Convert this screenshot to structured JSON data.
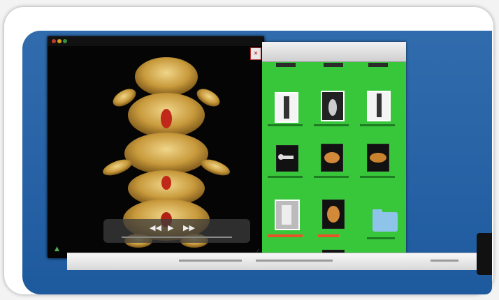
{
  "player": {
    "title": "",
    "close_glyph": "✕",
    "controls": {
      "prev": "◀◀",
      "play": "▶",
      "next": "▶▶"
    },
    "time_elapsed": "",
    "time_remaining": "",
    "fullscreen_icon": "fullscreen-icon",
    "resize_icon": "resize-icon"
  },
  "finder": {
    "background_color": "#38c63a",
    "items": [
      {
        "kind": "xray-dark"
      },
      {
        "kind": "xray-light"
      },
      {
        "kind": "xray-dark"
      },
      {
        "kind": "implant"
      },
      {
        "kind": "bone-3d"
      },
      {
        "kind": "bone-3d"
      },
      {
        "kind": "xray-light"
      },
      {
        "kind": "bone-3d"
      },
      {
        "kind": "folder"
      }
    ]
  },
  "colors": {
    "desktop": "#1f5fa6",
    "frame": "#ffffff",
    "player_bg": "#050505",
    "bone": "#c89a3c"
  }
}
